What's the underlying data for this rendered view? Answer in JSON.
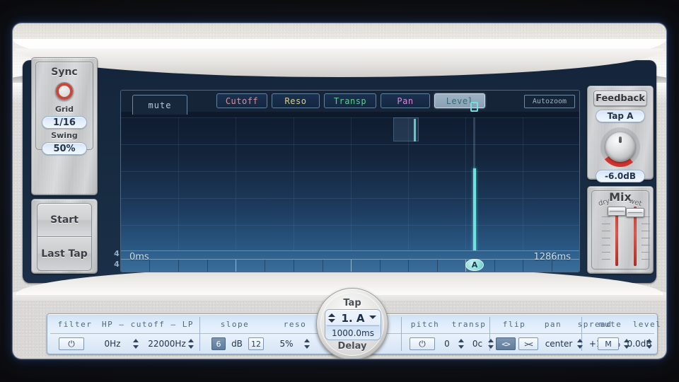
{
  "sync": {
    "title": "Sync",
    "led": "sync-led",
    "grid_label": "Grid",
    "grid_value": "1/16",
    "swing_label": "Swing",
    "swing_value": "50%"
  },
  "transport": {
    "start_label": "Start",
    "last_tap_label": "Last Tap"
  },
  "display": {
    "mute_tab": "mute",
    "autozoom": "Autozoom",
    "time_start": "0ms",
    "time_end": "1286ms",
    "time_signature_top": "4",
    "time_signature_bottom": "4",
    "tap_marker": "A",
    "tabs": [
      {
        "label": "Cutoff",
        "color": "#d4929c",
        "selected": false
      },
      {
        "label": "Reso",
        "color": "#d8d083",
        "selected": false
      },
      {
        "label": "Transp",
        "color": "#63c98f",
        "selected": false
      },
      {
        "label": "Pan",
        "color": "#cf8ad6",
        "selected": false
      },
      {
        "label": "Level",
        "color": "#5fdcdb",
        "selected": true
      }
    ]
  },
  "feedback": {
    "title": "Feedback",
    "tap_select": "Tap A",
    "value": "-6.0dB",
    "accent": "#d0342c"
  },
  "mix": {
    "title": "Mix",
    "dry_label": "dry",
    "wet_label": "wet",
    "accent": "#d0342c"
  },
  "parambar": {
    "filter": {
      "head_filter": "filter",
      "head_range": "HP — cutoff — LP",
      "power": "power-icon",
      "hp_value": "0Hz",
      "lp_value": "22000Hz"
    },
    "slope": {
      "head": "slope",
      "option_low": "6",
      "unit": "dB",
      "option_high": "12",
      "selected": "6"
    },
    "reso": {
      "head": "reso",
      "value": "5%"
    },
    "pitch": {
      "head_pitch": "pitch",
      "head_transp": "transp",
      "power": "power-icon",
      "semitones": "0",
      "cents": "0c"
    },
    "flip": {
      "head": "flip",
      "btn_a": "<>",
      "btn_b": "><",
      "selected": "<>"
    },
    "pan": {
      "head_pan": "pan",
      "head_spread": "spread",
      "pan_value": "center",
      "spread_value": "+100%"
    },
    "output": {
      "head_mute": "mute",
      "head_level": "level",
      "mute_btn": "M",
      "level_value": "0.0dB"
    }
  },
  "tapdial": {
    "top_label": "Tap",
    "bottom_label": "Delay",
    "tap_name": "1. A",
    "tap_time": "1000.0ms"
  }
}
